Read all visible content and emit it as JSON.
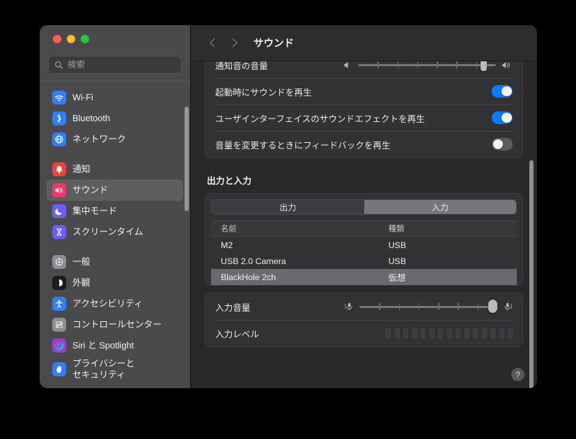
{
  "window": {
    "traffic_lights": [
      "close",
      "minimize",
      "zoom"
    ],
    "colors": {
      "close": "#ff5f57",
      "minimize": "#febc2e",
      "zoom": "#28c840",
      "accent": "#0a7cff"
    }
  },
  "sidebar": {
    "search": {
      "placeholder": "検索",
      "value": ""
    },
    "groups": [
      {
        "items": [
          {
            "label": "Wi-Fi",
            "icon": "wifi-icon",
            "color": "#2f80ff",
            "selected": false
          },
          {
            "label": "Bluetooth",
            "icon": "bluetooth-icon",
            "color": "#2f80ff",
            "selected": false
          },
          {
            "label": "ネットワーク",
            "icon": "globe-icon",
            "color": "#2f80ff",
            "selected": false
          }
        ]
      },
      {
        "items": [
          {
            "label": "通知",
            "icon": "bell-icon",
            "color": "#e8453c",
            "selected": false
          },
          {
            "label": "サウンド",
            "icon": "speaker-icon",
            "color": "#f5386a",
            "selected": true
          },
          {
            "label": "集中モード",
            "icon": "moon-icon",
            "color": "#6b5ef5",
            "selected": false
          },
          {
            "label": "スクリーンタイム",
            "icon": "hourglass-icon",
            "color": "#6b5ef5",
            "selected": false
          }
        ]
      },
      {
        "items": [
          {
            "label": "一般",
            "icon": "gear-icon",
            "color": "#8e8e93",
            "selected": false
          },
          {
            "label": "外観",
            "icon": "appearance-icon",
            "color": "#1c1c1e",
            "selected": false
          },
          {
            "label": "アクセシビリティ",
            "icon": "accessibility-icon",
            "color": "#2f80ff",
            "selected": false
          },
          {
            "label": "コントロールセンター",
            "icon": "control-center-icon",
            "color": "#8e8e93",
            "selected": false
          },
          {
            "label": "Siri と Spotlight",
            "icon": "siri-icon",
            "color": "#9b3fd1",
            "selected": false
          },
          {
            "label": "プライバシーと\nセキュリティ",
            "icon": "hand-icon",
            "color": "#2f80ff",
            "selected": false
          }
        ]
      }
    ]
  },
  "toolbar": {
    "back_label": "back",
    "forward_label": "forward",
    "title": "サウンド"
  },
  "main": {
    "sound_card": {
      "rows": [
        {
          "label": "通知音の音量",
          "control": "slider",
          "value": 93,
          "ticks": 6
        },
        {
          "label": "起動時にサウンドを再生",
          "control": "toggle",
          "on": true
        },
        {
          "label": "ユーザインターフェイスのサウンドエフェクトを再生",
          "control": "toggle",
          "on": true
        },
        {
          "label": "音量を変更するときにフィードバックを再生",
          "control": "toggle",
          "on": false
        }
      ]
    },
    "io_section": {
      "heading": "出力と入力",
      "tabs": [
        {
          "label": "出力",
          "active": false
        },
        {
          "label": "入力",
          "active": true
        }
      ],
      "table": {
        "columns": [
          "名前",
          "種類"
        ],
        "rows": [
          {
            "name": "M2",
            "type": "USB",
            "selected": false
          },
          {
            "name": "USB 2.0 Camera",
            "type": "USB",
            "selected": false
          },
          {
            "name": "BlackHole 2ch",
            "type": "仮想",
            "selected": true
          }
        ]
      }
    },
    "input_card": {
      "volume_label": "入力音量",
      "volume_value": 100,
      "volume_ticks": 6,
      "level_label": "入力レベル",
      "level_segments": 15,
      "level_active": 0
    },
    "help_label": "?"
  }
}
